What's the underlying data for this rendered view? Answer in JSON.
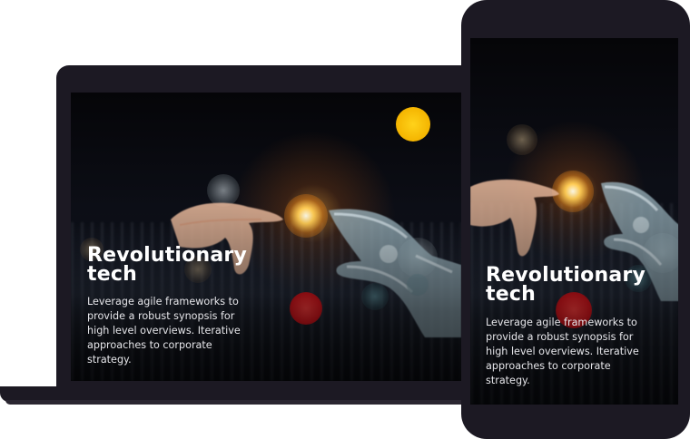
{
  "hero": {
    "title": "Revolutionary tech",
    "body": "Leverage agile frameworks to provide a robust synopsis for high level overviews. Iterative approaches to corporate strategy."
  },
  "colors": {
    "device_frame": "#1c1923",
    "title_text": "#ffffff",
    "body_text": "#e6e6ea",
    "bokeh_yellow": "#f4b400",
    "bokeh_red": "#d8141c",
    "glow_orange": "#ffaa3c"
  },
  "icons": [
    "human-hand-image",
    "robot-hand-image",
    "light-spark-image"
  ]
}
